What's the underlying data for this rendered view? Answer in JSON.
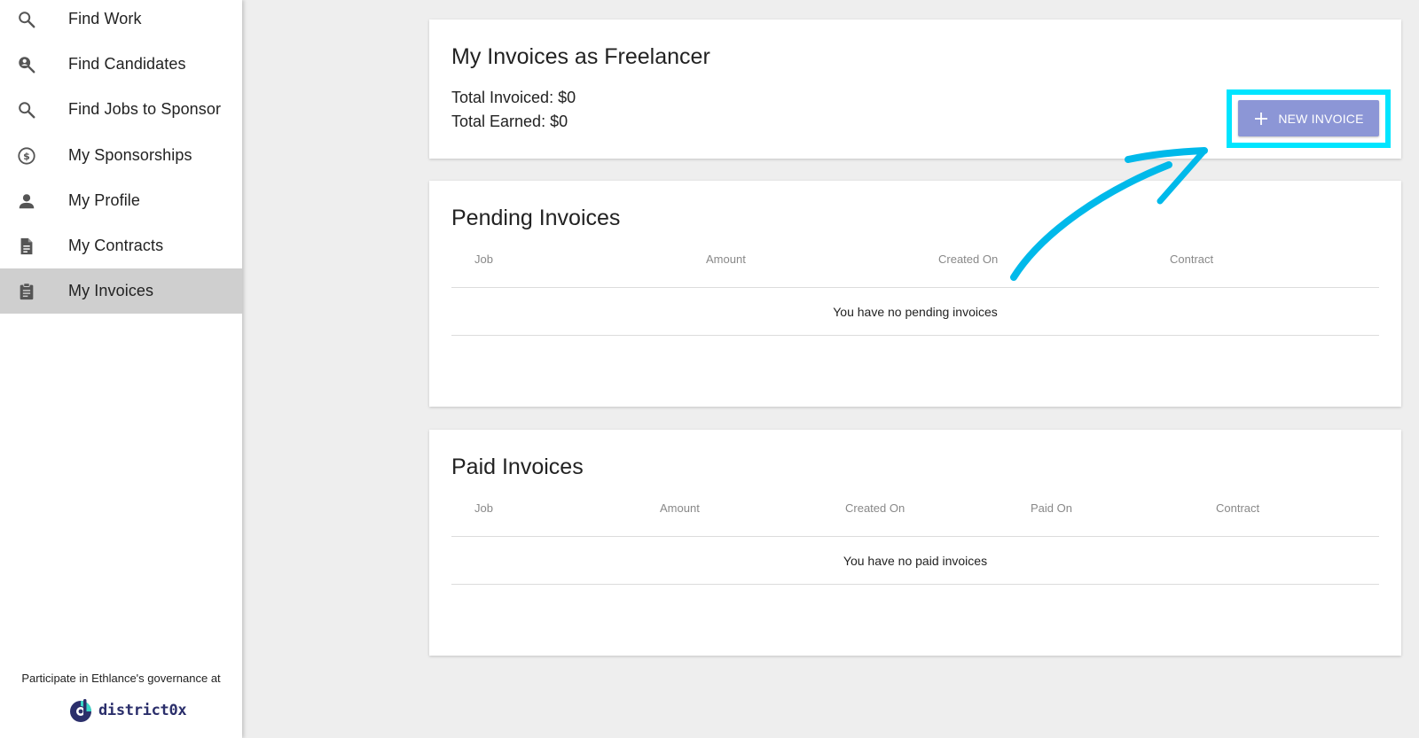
{
  "sidebar": {
    "items": [
      {
        "label": "Find Work",
        "icon": "search-icon"
      },
      {
        "label": "Find Candidates",
        "icon": "person-search-icon"
      },
      {
        "label": "Find Jobs to Sponsor",
        "icon": "search-icon"
      },
      {
        "label": "My Sponsorships",
        "icon": "dollar-circle-icon"
      },
      {
        "label": "My Profile",
        "icon": "person-icon"
      },
      {
        "label": "My Contracts",
        "icon": "document-icon"
      },
      {
        "label": "My Invoices",
        "icon": "clipboard-icon",
        "active": true
      }
    ],
    "governance_text": "Participate in Ethlance's governance at",
    "logo_text": "district0x"
  },
  "summary": {
    "title": "My Invoices as Freelancer",
    "total_invoiced": "Total Invoiced: $0",
    "total_earned": "Total Earned: $0",
    "new_invoice_label": "NEW INVOICE"
  },
  "pending": {
    "title": "Pending Invoices",
    "columns": [
      "Job",
      "Amount",
      "Created On",
      "Contract"
    ],
    "empty_message": "You have no pending invoices"
  },
  "paid": {
    "title": "Paid Invoices",
    "columns": [
      "Job",
      "Amount",
      "Created On",
      "Paid On",
      "Contract"
    ],
    "empty_message": "You have no paid invoices"
  },
  "colors": {
    "accent_button": "#8c96d6",
    "highlight": "#00e5ff",
    "annotation_arrow": "#00b9ea",
    "active_nav": "#cfcfcf",
    "logo": "#2b2f6b"
  }
}
